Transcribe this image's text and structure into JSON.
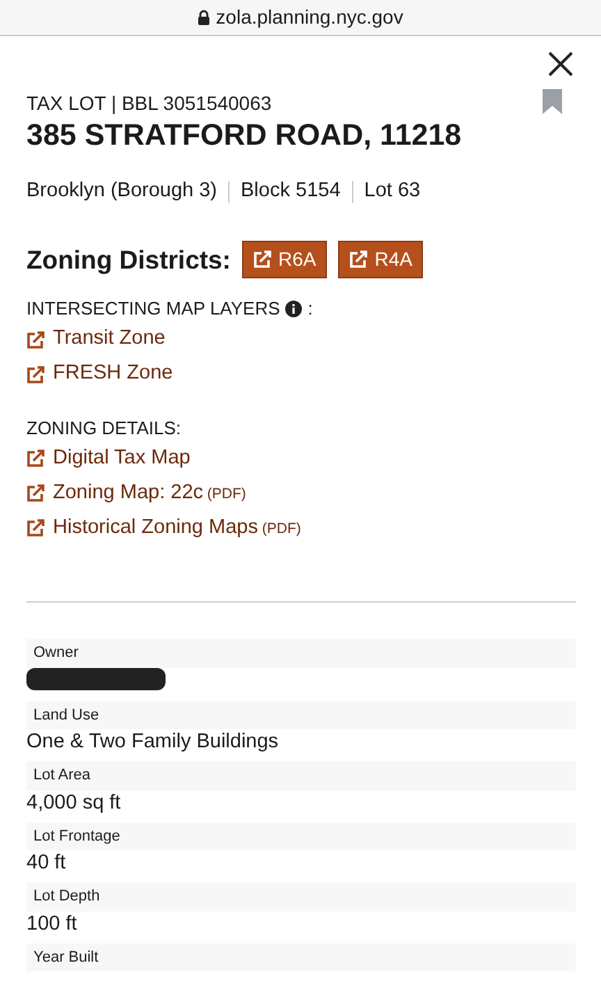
{
  "browser": {
    "url": "zola.planning.nyc.gov"
  },
  "header": {
    "subtitle": "TAX LOT | BBL 3051540063",
    "title": "385 STRATFORD ROAD, 11218",
    "bookmarked": false
  },
  "meta": [
    "Brooklyn (Borough 3)",
    "Block 5154",
    "Lot 63"
  ],
  "zoning_districts": {
    "label": "Zoning Districts:",
    "badges": [
      "R6A",
      "R4A"
    ]
  },
  "intersecting_layers": {
    "heading": "INTERSECTING MAP LAYERS",
    "suffix": ":",
    "links": [
      {
        "label": "Transit Zone"
      },
      {
        "label": "FRESH Zone"
      }
    ]
  },
  "zoning_details": {
    "heading": "ZONING DETAILS:",
    "links": [
      {
        "label": "Digital Tax Map"
      },
      {
        "label": "Zoning Map: 22c",
        "note": "(PDF)"
      },
      {
        "label": "Historical Zoning Maps",
        "note": "(PDF)"
      }
    ]
  },
  "fields": [
    {
      "label": "Owner",
      "redacted": true
    },
    {
      "label": "Land Use",
      "value": "One & Two Family Buildings"
    },
    {
      "label": "Lot Area",
      "value": "4,000 sq ft"
    },
    {
      "label": "Lot Frontage",
      "value": "40 ft"
    },
    {
      "label": "Lot Depth",
      "value": "100 ft"
    },
    {
      "label": "Year Built"
    }
  ]
}
